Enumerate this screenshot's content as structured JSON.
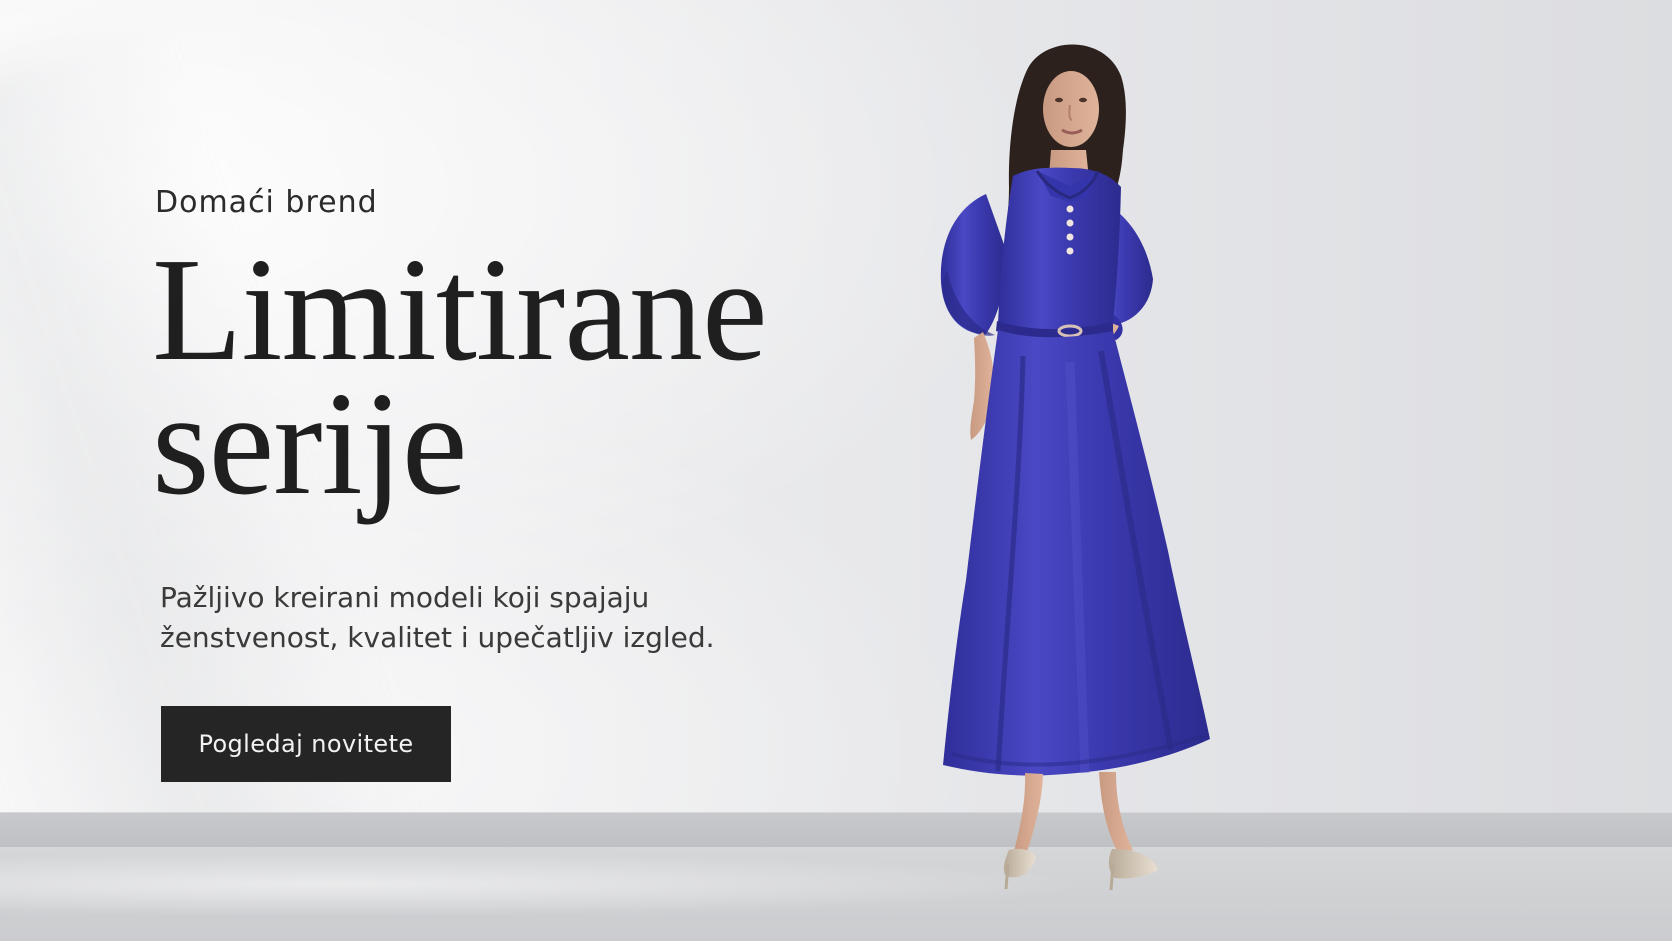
{
  "hero": {
    "eyebrow": "Domaći brend",
    "headline_line_1": "Limitirane",
    "headline_line_2": "serije",
    "subtitle_line_1": "Pažljivo kreirani modeli koji spajaju",
    "subtitle_line_2": "ženstvenost, kvalitet i upečatljiv izgled.",
    "cta_label": "Pogledaj novitete"
  },
  "colors": {
    "dress": "#3d3cb0",
    "button_bg": "#252525",
    "button_text": "#f2f2f2",
    "text": "#1f1f1f"
  }
}
